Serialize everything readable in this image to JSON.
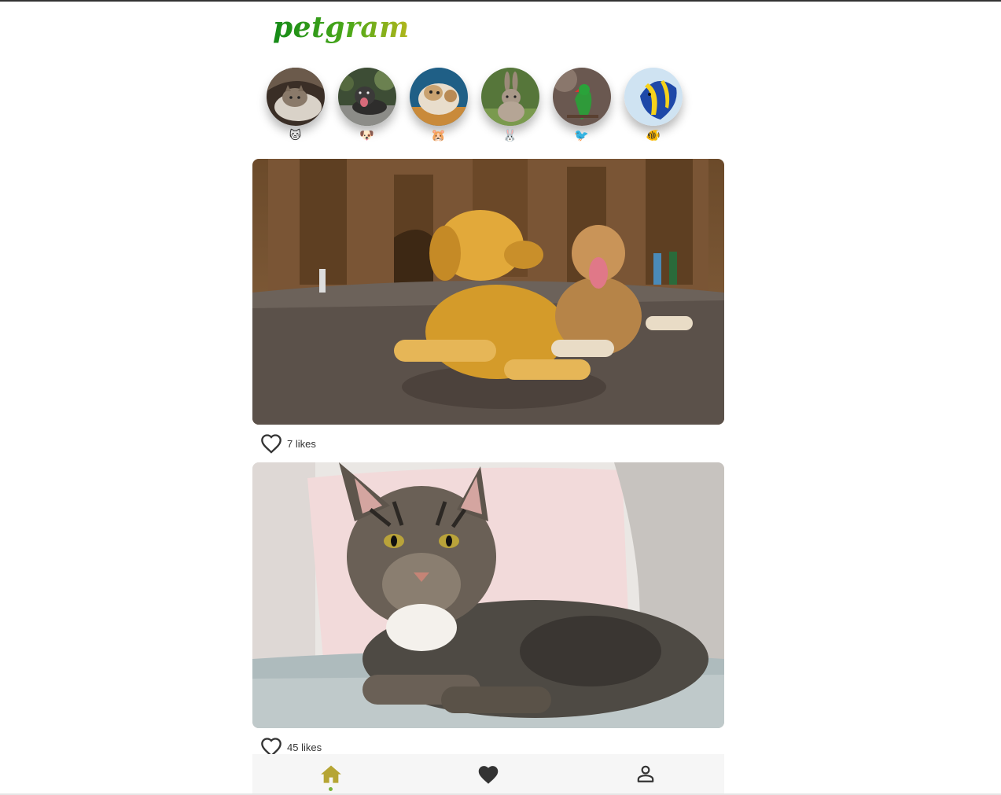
{
  "app": {
    "logo": "petgram"
  },
  "stories": [
    {
      "name": "cat",
      "emoji": "🐱",
      "icon": "cat-face-icon",
      "bg": "#5b4a3b"
    },
    {
      "name": "dog",
      "emoji": "🐶",
      "icon": "dog-face-icon",
      "bg": "#4f5e48"
    },
    {
      "name": "hamster",
      "emoji": "🐹",
      "icon": "hamster-face-icon",
      "bg": "#2d6d8e"
    },
    {
      "name": "rabbit",
      "emoji": "🐰",
      "icon": "rabbit-face-icon",
      "bg": "#5d7a3e"
    },
    {
      "name": "bird",
      "emoji": "🐦",
      "icon": "bird-icon",
      "bg": "#6e5a50"
    },
    {
      "name": "fish",
      "emoji": "🐠",
      "icon": "fish-icon",
      "bg": "#bcd8ec"
    }
  ],
  "posts": [
    {
      "subject": "dogs",
      "likes": "7 likes"
    },
    {
      "subject": "cat",
      "likes": "45 likes"
    }
  ],
  "nav": {
    "items": [
      {
        "name": "home",
        "icon": "home-icon",
        "active": true
      },
      {
        "name": "favorites",
        "icon": "heart-icon",
        "active": false
      },
      {
        "name": "user",
        "icon": "user-icon",
        "active": false
      }
    ],
    "active_color": "#b6a534",
    "dot_color": "#7bb33a"
  }
}
